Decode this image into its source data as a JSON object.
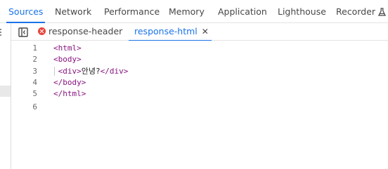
{
  "top_tabs": [
    {
      "label": "Sources",
      "active": true
    },
    {
      "label": "Network",
      "active": false
    },
    {
      "label": "Performance",
      "active": false
    },
    {
      "label": "Memory",
      "active": false
    },
    {
      "label": "Application",
      "active": false
    },
    {
      "label": "Lighthouse",
      "active": false
    },
    {
      "label": "Recorder",
      "active": false,
      "icon": "flask-icon"
    }
  ],
  "file_tabs": [
    {
      "label": "response-header",
      "icon": "error-icon",
      "active": false
    },
    {
      "label": "response-html",
      "active": true,
      "close": "✕"
    }
  ],
  "editor": {
    "lines": [
      {
        "num": "1",
        "tag": "<html>",
        "text": ""
      },
      {
        "num": "2",
        "tag": "<body>",
        "text": ""
      },
      {
        "num": "3",
        "open": " <div>",
        "text": "안녕?",
        "close": "</div>"
      },
      {
        "num": "4",
        "tag": "</body>",
        "text": ""
      },
      {
        "num": "5",
        "tag": "</html>",
        "text": ""
      },
      {
        "num": "6",
        "tag": "",
        "text": ""
      }
    ]
  },
  "colors": {
    "accent": "#1a73e8",
    "tag": "#881280",
    "error": "#e8453c"
  }
}
